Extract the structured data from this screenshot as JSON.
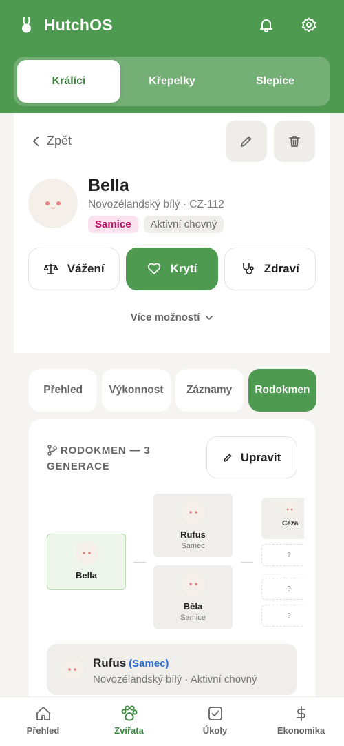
{
  "app": {
    "title": "HutchOS"
  },
  "species_tabs": [
    {
      "label": "Králíci",
      "active": true
    },
    {
      "label": "Křepelky",
      "active": false
    },
    {
      "label": "Slepice",
      "active": false
    }
  ],
  "profile": {
    "back_label": "Zpět",
    "name": "Bella",
    "breed_line": "Novozélandský bílý · CZ-112",
    "sex_badge": "Samice",
    "status_badge": "Aktivní chovný",
    "actions": {
      "weigh": "Vážení",
      "breed": "Krytí",
      "health": "Zdraví"
    },
    "more_label": "Více možností"
  },
  "detail_tabs": [
    {
      "label": "Přehled",
      "active": false
    },
    {
      "label": "Výkonnost",
      "active": false
    },
    {
      "label": "Záznamy",
      "active": false
    },
    {
      "label": "Rodokmen",
      "active": true
    }
  ],
  "pedigree": {
    "title": "RODOKMEN — 3 GENERACE",
    "edit_label": "Upravit",
    "self": {
      "name": "Bella"
    },
    "sire": {
      "name": "Rufus",
      "sex": "Samec"
    },
    "dam": {
      "name": "Běla",
      "sex": "Samice"
    },
    "grandparent_partial": "Céza",
    "unknown": "?",
    "selected": {
      "name": "Rufus",
      "sex": "(Samec)",
      "description": "Novozélandský bílý · Aktivní chovný"
    }
  },
  "bottom_nav": [
    {
      "label": "Přehled",
      "icon": "home-icon",
      "active": false
    },
    {
      "label": "Zvířata",
      "icon": "paw-icon",
      "active": true
    },
    {
      "label": "Úkoly",
      "icon": "checkbox-icon",
      "active": false
    },
    {
      "label": "Ekonomika",
      "icon": "dollar-icon",
      "active": false
    }
  ],
  "colors": {
    "primary": "#4e9a50",
    "accent_blue": "#2a6fd6",
    "female_pink": "#b8105f"
  }
}
